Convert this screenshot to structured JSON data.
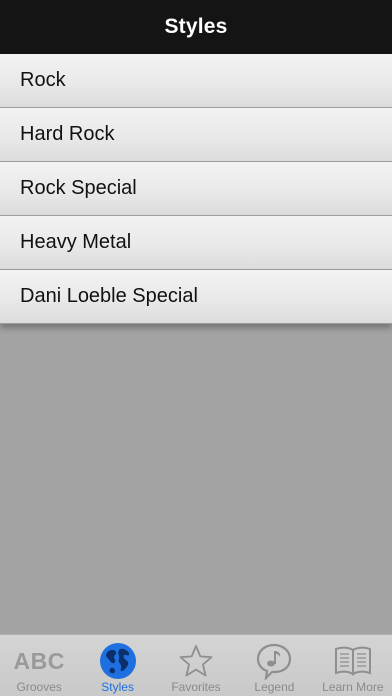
{
  "navbar": {
    "title": "Styles"
  },
  "styles": {
    "items": [
      {
        "label": "Rock"
      },
      {
        "label": "Hard Rock"
      },
      {
        "label": "Rock Special"
      },
      {
        "label": "Heavy Metal"
      },
      {
        "label": "Dani Loeble Special"
      }
    ]
  },
  "tabbar": {
    "tabs": [
      {
        "label": "Grooves",
        "icon": "abc-icon",
        "icon_text": "ABC"
      },
      {
        "label": "Styles",
        "icon": "globe-icon",
        "active": true
      },
      {
        "label": "Favorites",
        "icon": "star-icon"
      },
      {
        "label": "Legend",
        "icon": "music-note-icon"
      },
      {
        "label": "Learn More",
        "icon": "book-icon"
      }
    ],
    "active_color": "#1e6fe0",
    "inactive_color": "#8a8a8a"
  }
}
